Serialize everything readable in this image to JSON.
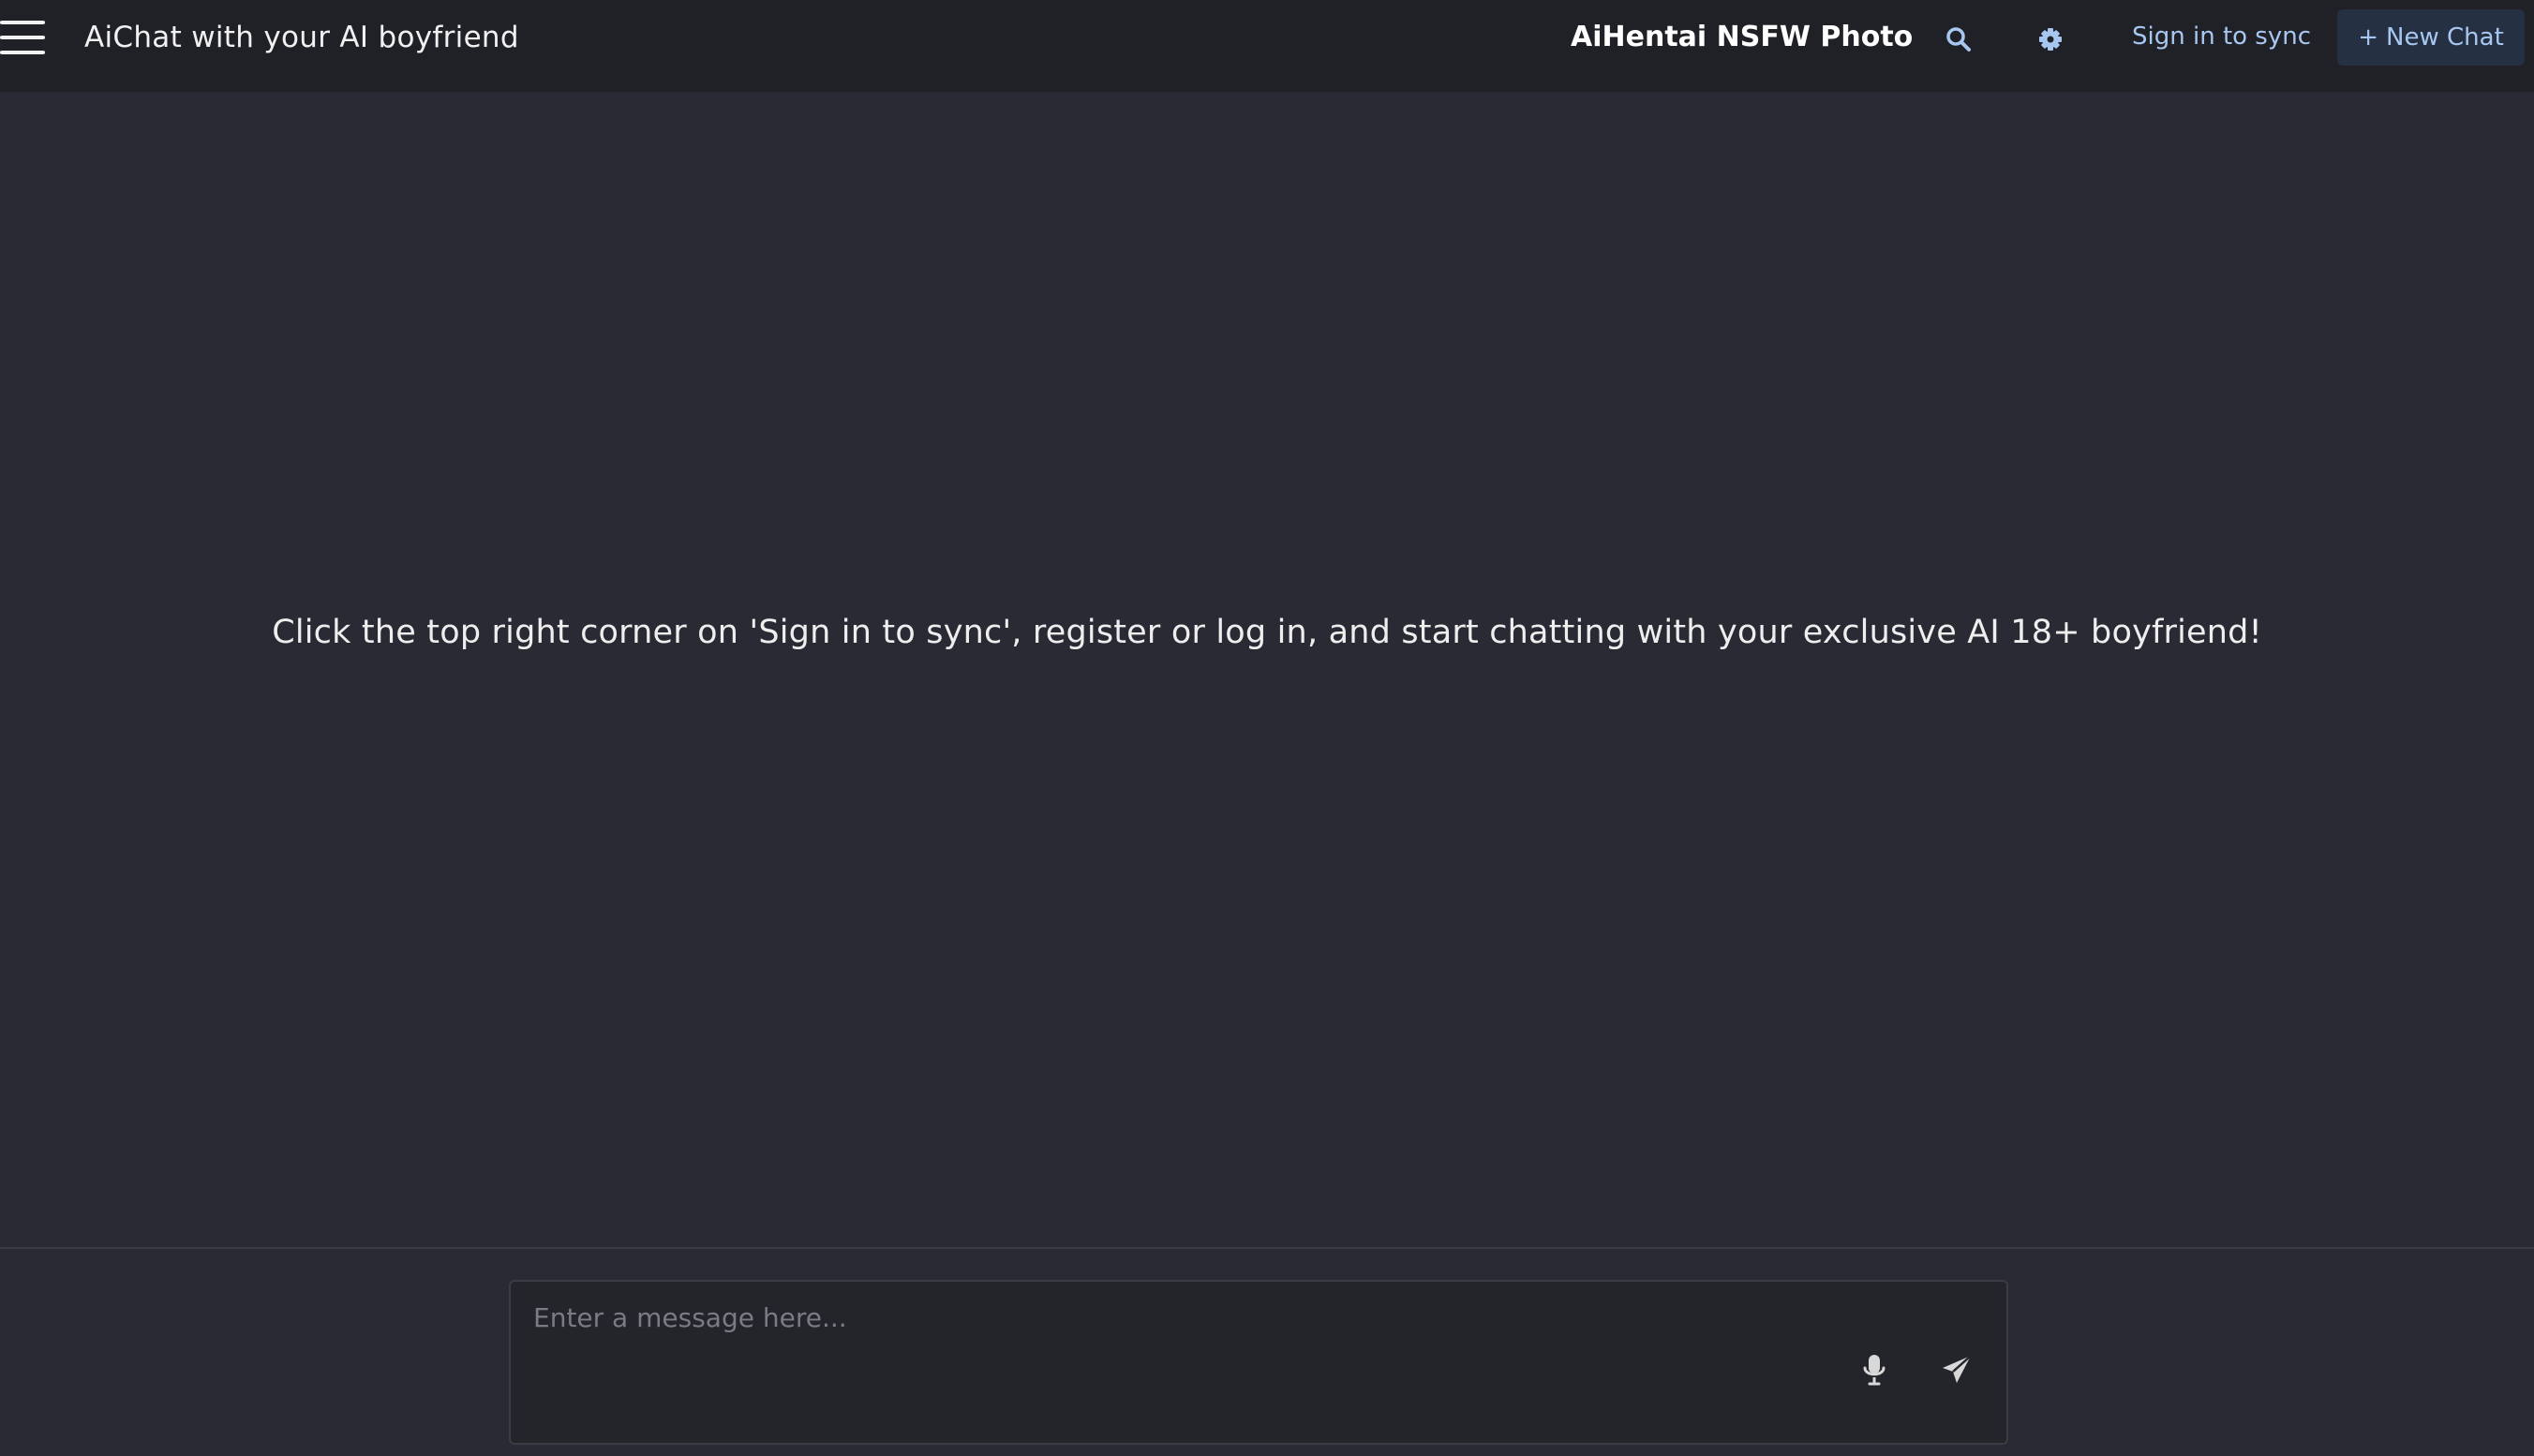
{
  "header": {
    "app_title": "AiChat with your AI boyfriend",
    "promo_link": "AiHentai NSFW Photo",
    "sign_in_label": "Sign in to sync",
    "new_chat_label": "New Chat",
    "new_chat_prefix": "+",
    "icons": {
      "menu": "hamburger-menu-icon",
      "search": "search-icon",
      "settings": "gear-icon"
    }
  },
  "main": {
    "message": "Click the top right corner on 'Sign in to sync', register or log in, and start chatting with your exclusive AI 18+ boyfriend!"
  },
  "composer": {
    "placeholder": "Enter a message here...",
    "value": "",
    "icons": {
      "voice": "microphone-icon",
      "send": "paper-plane-icon"
    }
  },
  "colors": {
    "background": "#292a33",
    "header_background": "#202126",
    "accent_text": "#a8c7f0",
    "new_chat_background": "#263043",
    "composer_background": "#24252b"
  }
}
